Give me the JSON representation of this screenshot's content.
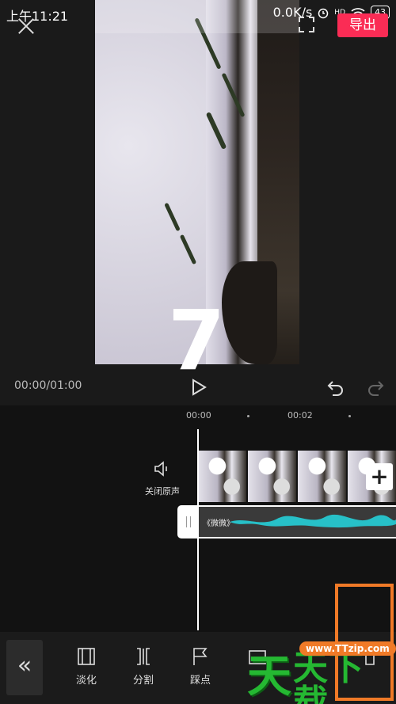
{
  "statusbar": {
    "time": "上午11:21",
    "network": "0.0K/s",
    "signal_label": "HD",
    "battery": "43"
  },
  "header": {
    "export_label": "导出"
  },
  "preview": {
    "countdown": "7",
    "timecode": "00:00/01:00"
  },
  "timeline": {
    "ruler": [
      "00:00",
      "00:02"
    ],
    "mute_label": "关闭原声",
    "audio_name": "《微微》",
    "add_symbol": "+"
  },
  "toolbar": {
    "back_symbol": "«",
    "tools": [
      {
        "label": "淡化"
      },
      {
        "label": "分割"
      },
      {
        "label": "踩点"
      }
    ]
  },
  "watermark": {
    "big": "天",
    "rest": "天下载",
    "site": "www.TTzip.com"
  },
  "colors": {
    "accent": "#fa2c55",
    "highlight": "#f07a27",
    "waveform": "#27c0c8",
    "watermark": "#25b832"
  }
}
